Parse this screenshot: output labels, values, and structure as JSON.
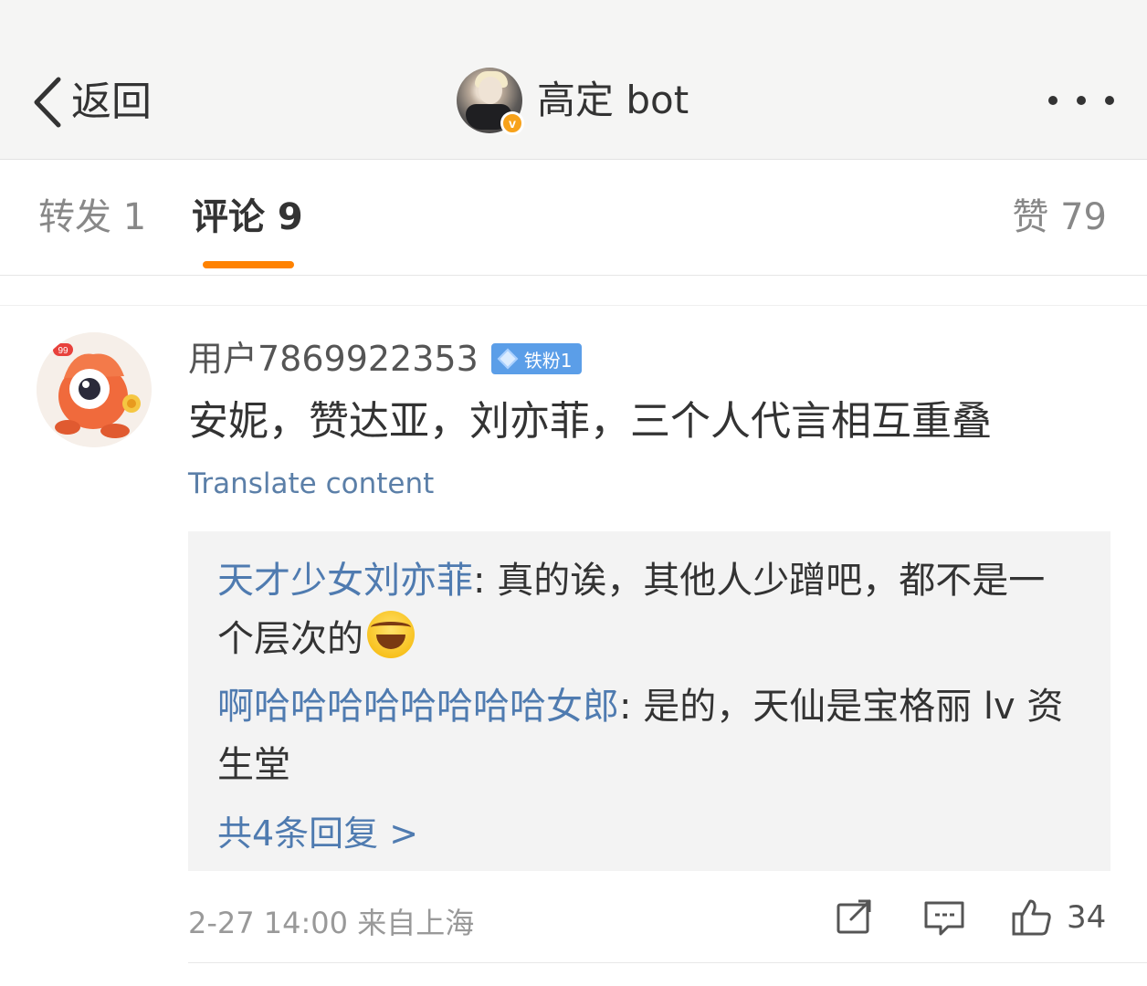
{
  "nav": {
    "back_label": "返回",
    "title": "高定 bot",
    "verified_badge": "v"
  },
  "tabs": {
    "repost": "转发 1",
    "comment": "评论 9",
    "like": "赞 79"
  },
  "comment": {
    "avatar_badge": "99",
    "username": "用户7869922353",
    "fan_badge": "铁粉1",
    "text": "安妮，赞达亚，刘亦菲，三个人代言相互重叠",
    "translate_link": "Translate content",
    "replies": [
      {
        "author": "天才少女刘亦菲",
        "separator": ": ",
        "text": "真的诶，其他人少蹭吧，都不是一个层次的"
      },
      {
        "author": "啊哈哈哈哈哈哈哈哈女郎",
        "separator": ": ",
        "text": "是的，天仙是宝格丽 lv 资生堂"
      }
    ],
    "more_replies": "共4条回复 >",
    "meta": "2-27 14:00  来自上海",
    "like_count": "34"
  },
  "colors": {
    "accent": "#ff8200",
    "link": "#4f7bb0",
    "fan_badge": "#5b9ee8"
  }
}
